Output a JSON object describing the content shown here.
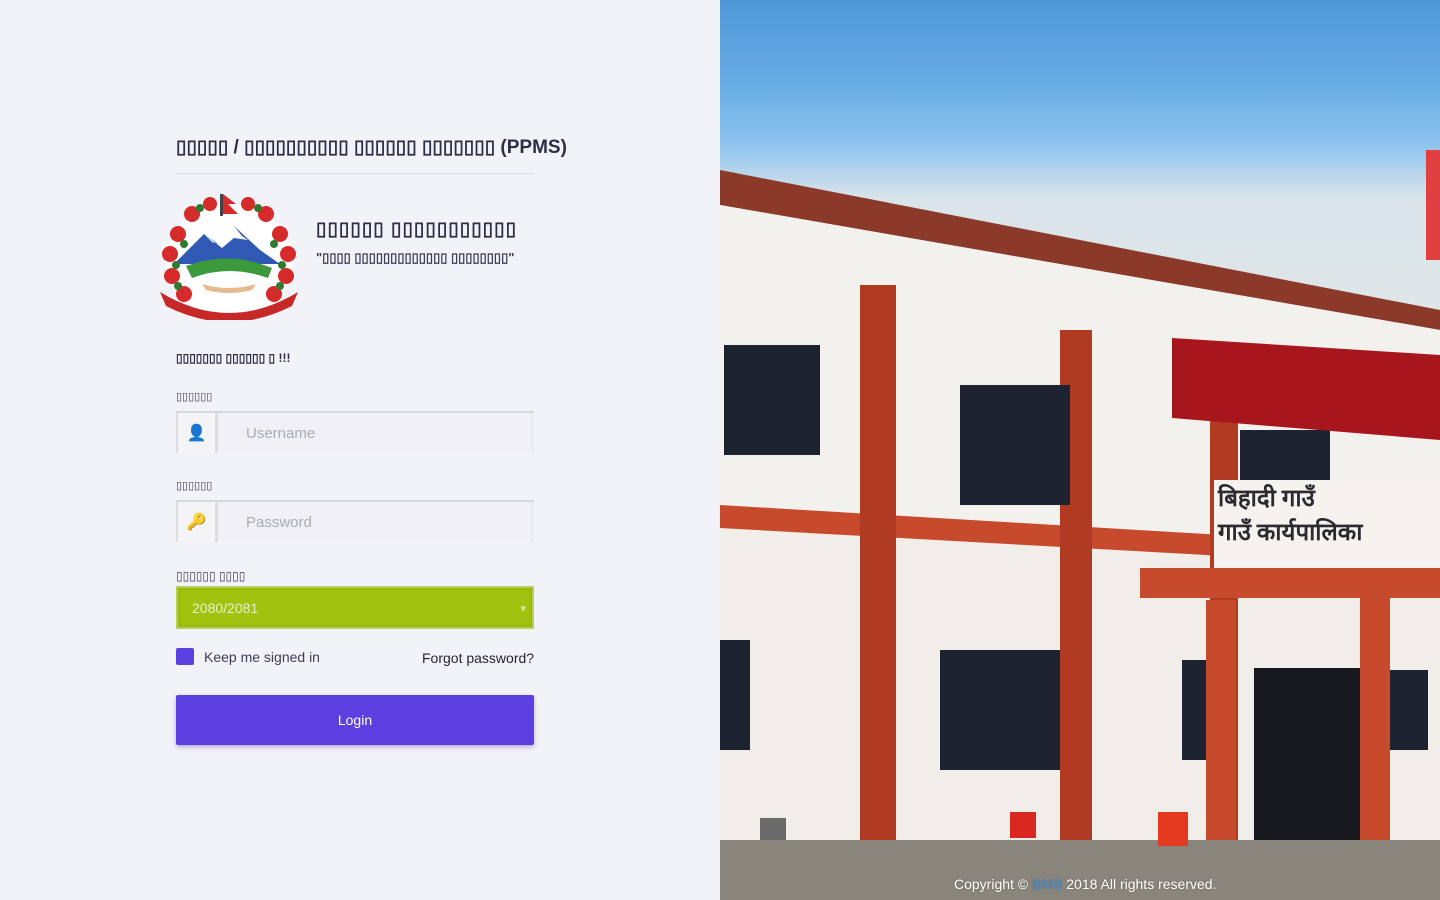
{
  "header": {
    "app_title": "▯▯▯▯▯ / ▯▯▯▯▯▯▯▯▯▯ ▯▯▯▯▯▯ ▯▯▯▯▯▯▯ (PPMS)"
  },
  "organization": {
    "name": "▯▯▯▯▯▯ ▯▯▯▯▯▯▯▯▯▯▯",
    "slogan": "\"▯▯▯▯ ▯▯▯▯▯▯▯▯▯▯▯▯▯ ▯▯▯▯▯▯▯▯\""
  },
  "login_form": {
    "welcome": "▯▯▯▯▯▯▯ ▯▯▯▯▯▯ ▯ !!!",
    "username_label": "▯▯▯▯▯▯",
    "username_placeholder": "Username",
    "password_label": "▯▯▯▯▯▯",
    "password_placeholder": "Password",
    "fiscal_year_label": "▯▯▯▯▯▯ ▯▯▯▯",
    "fiscal_year_value": "2080/2081",
    "remember_label": "Keep me signed in",
    "remember_checked": true,
    "forgot_label": "Forgot password?",
    "login_label": "Login"
  },
  "icons": {
    "username": "user-icon",
    "password": "key-icon"
  },
  "colors": {
    "primary": "#5b3fe0",
    "fiscal_select_bg": "#a0c30f",
    "brand_link": "#2f8de4"
  },
  "footer": {
    "copyright_prefix": "Copyright ©",
    "brand": "BMS",
    "copyright_suffix": "2018 All rights reserved."
  },
  "building_sign": {
    "line1": "बिहादी गाउँ",
    "line2": "गाउँ कार्यपालिका"
  }
}
